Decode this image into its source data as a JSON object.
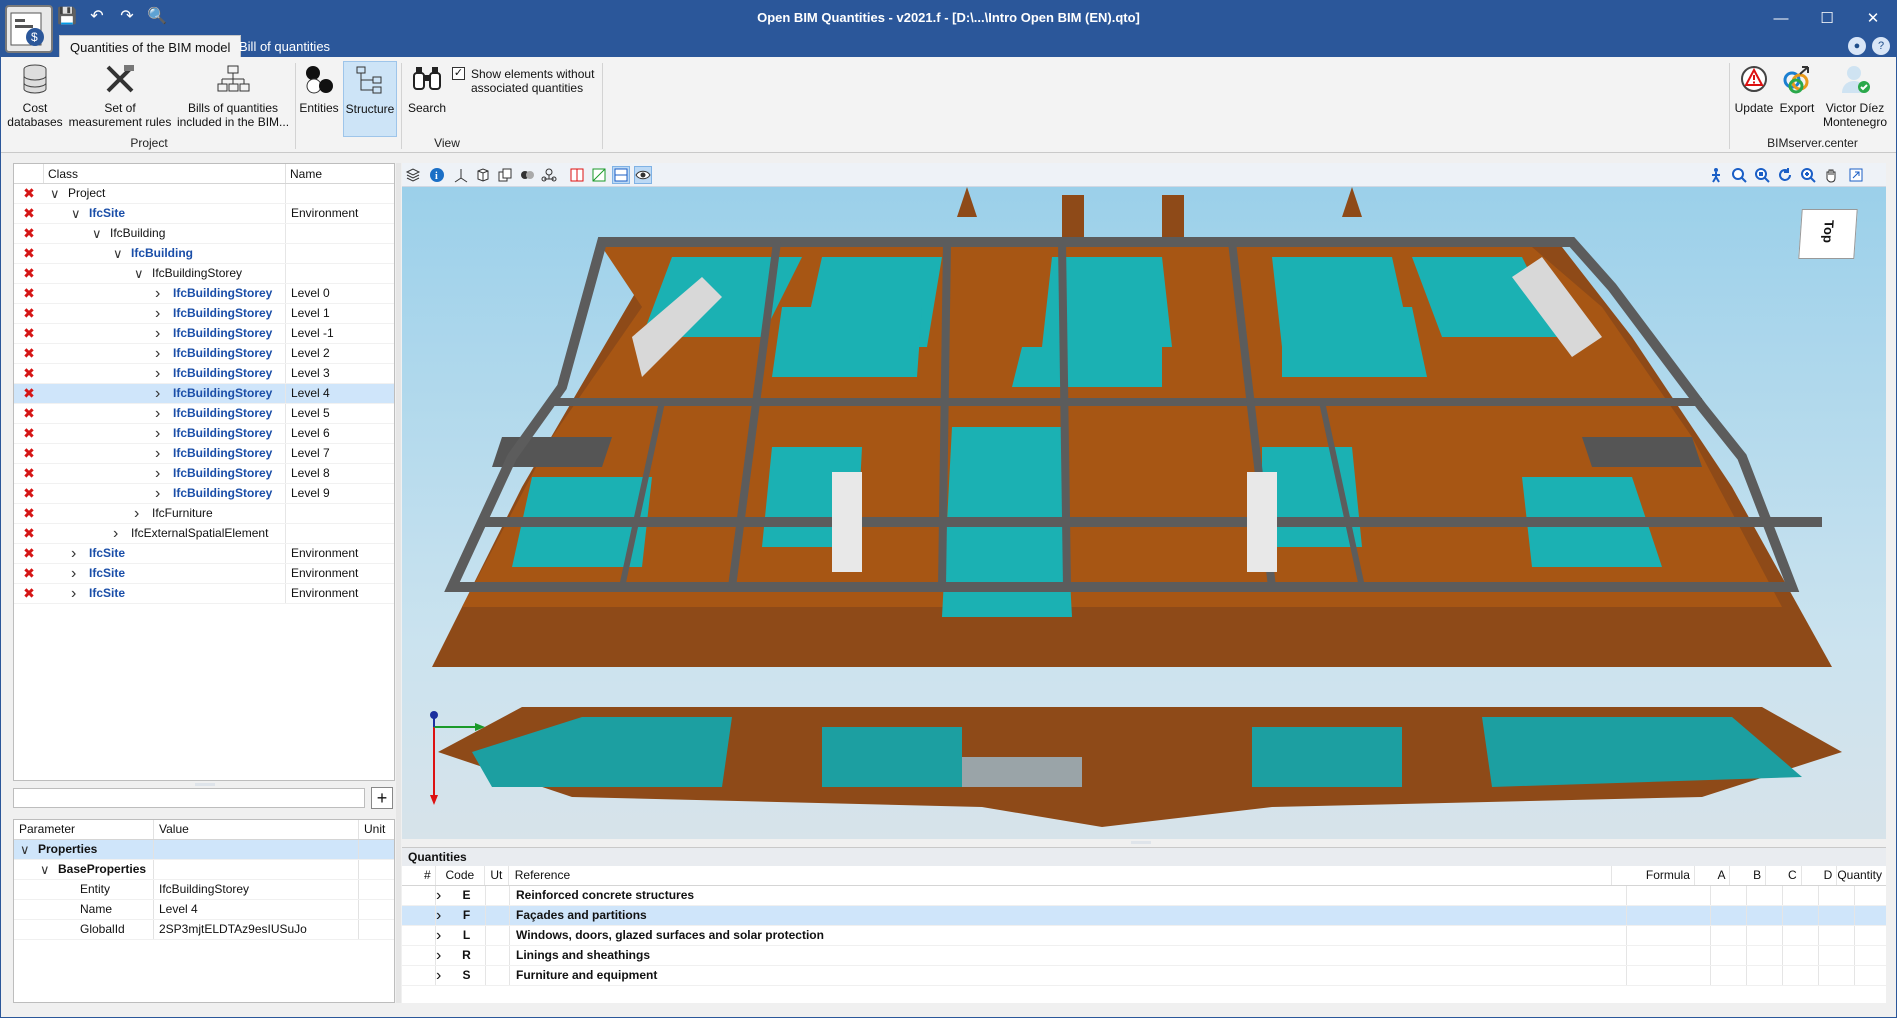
{
  "window": {
    "title": "Open BIM Quantities - v2021.f - [D:\\...\\Intro Open BIM (EN).qto]",
    "controls": [
      "minimize-icon",
      "maximize-icon",
      "close-icon"
    ]
  },
  "ribbon_tabs": [
    {
      "label": "Quantities of the BIM model",
      "active": true
    },
    {
      "label": "Bill of quantities",
      "active": false
    }
  ],
  "ribbon": {
    "cost_databases": "Cost\ndatabases",
    "measurement_rules": "Set of\nmeasurement rules",
    "bills_included": "Bills of quantities\nincluded in the BIM...",
    "project_group": "Project",
    "entities": "Entities",
    "structure": "Structure",
    "search": "Search",
    "show_elements": "Show elements without\nassociated quantities",
    "view_group": "View",
    "update": "Update",
    "export": "Export",
    "user": "Victor Díez\nMontenegro",
    "bimserver_group": "BIMserver.center"
  },
  "tree": {
    "headers": {
      "class": "Class",
      "name": "Name"
    },
    "rows": [
      {
        "depth": 0,
        "expanded": true,
        "cls": "Project",
        "name": "",
        "blue": false
      },
      {
        "depth": 1,
        "expanded": true,
        "cls": "IfcSite",
        "name": "Environment",
        "blue": true
      },
      {
        "depth": 2,
        "expanded": true,
        "cls": "IfcBuilding",
        "name": "",
        "blue": false
      },
      {
        "depth": 3,
        "expanded": true,
        "cls": "IfcBuilding",
        "name": "",
        "blue": true
      },
      {
        "depth": 4,
        "expanded": true,
        "cls": "IfcBuildingStorey",
        "name": "",
        "blue": false
      },
      {
        "depth": 5,
        "expanded": false,
        "cls": "IfcBuildingStorey",
        "name": "Level 0",
        "blue": true
      },
      {
        "depth": 5,
        "expanded": false,
        "cls": "IfcBuildingStorey",
        "name": "Level 1",
        "blue": true
      },
      {
        "depth": 5,
        "expanded": false,
        "cls": "IfcBuildingStorey",
        "name": "Level -1",
        "blue": true
      },
      {
        "depth": 5,
        "expanded": false,
        "cls": "IfcBuildingStorey",
        "name": "Level 2",
        "blue": true
      },
      {
        "depth": 5,
        "expanded": false,
        "cls": "IfcBuildingStorey",
        "name": "Level 3",
        "blue": true
      },
      {
        "depth": 5,
        "expanded": false,
        "cls": "IfcBuildingStorey",
        "name": "Level 4",
        "blue": true,
        "selected": true
      },
      {
        "depth": 5,
        "expanded": false,
        "cls": "IfcBuildingStorey",
        "name": "Level 5",
        "blue": true
      },
      {
        "depth": 5,
        "expanded": false,
        "cls": "IfcBuildingStorey",
        "name": "Level 6",
        "blue": true
      },
      {
        "depth": 5,
        "expanded": false,
        "cls": "IfcBuildingStorey",
        "name": "Level 7",
        "blue": true
      },
      {
        "depth": 5,
        "expanded": false,
        "cls": "IfcBuildingStorey",
        "name": "Level 8",
        "blue": true
      },
      {
        "depth": 5,
        "expanded": false,
        "cls": "IfcBuildingStorey",
        "name": "Level 9",
        "blue": true
      },
      {
        "depth": 4,
        "expanded": false,
        "cls": "IfcFurniture",
        "name": "",
        "blue": false
      },
      {
        "depth": 3,
        "expanded": false,
        "cls": "IfcExternalSpatialElement",
        "name": "",
        "blue": false
      },
      {
        "depth": 1,
        "expanded": false,
        "cls": "IfcSite",
        "name": "Environment",
        "blue": true
      },
      {
        "depth": 1,
        "expanded": false,
        "cls": "IfcSite",
        "name": "Environment",
        "blue": true
      },
      {
        "depth": 1,
        "expanded": false,
        "cls": "IfcSite",
        "name": "Environment",
        "blue": true
      }
    ]
  },
  "properties": {
    "headers": {
      "parameter": "Parameter",
      "value": "Value",
      "unit": "Unit"
    },
    "section": "Properties",
    "subsection": "BaseProperties",
    "rows": [
      {
        "param": "Entity",
        "value": "IfcBuildingStorey",
        "unit": ""
      },
      {
        "param": "Name",
        "value": "Level 4",
        "unit": ""
      },
      {
        "param": "GlobalId",
        "value": "2SP3mjtELDTAz9esIUSuJo",
        "unit": ""
      }
    ]
  },
  "viewer": {
    "cube_label": "Top"
  },
  "quantities": {
    "title": "Quantities",
    "headers": {
      "num": "#",
      "code": "Code",
      "ut": "Ut",
      "reference": "Reference",
      "formula": "Formula",
      "a": "A",
      "b": "B",
      "c": "C",
      "d": "D",
      "quantity": "Quantity"
    },
    "rows": [
      {
        "code": "E",
        "reference": "Reinforced concrete structures"
      },
      {
        "code": "F",
        "reference": "Façades and partitions",
        "selected": true
      },
      {
        "code": "L",
        "reference": "Windows, doors, glazed surfaces and solar protection"
      },
      {
        "code": "R",
        "reference": "Linings and sheathings"
      },
      {
        "code": "S",
        "reference": "Furniture and equipment"
      }
    ]
  },
  "colors": {
    "titlebar": "#2b579a",
    "selection": "#cfe5fa",
    "wood": "#b5560f",
    "teal": "#1bb1b3",
    "wall": "#6f6f6f"
  }
}
